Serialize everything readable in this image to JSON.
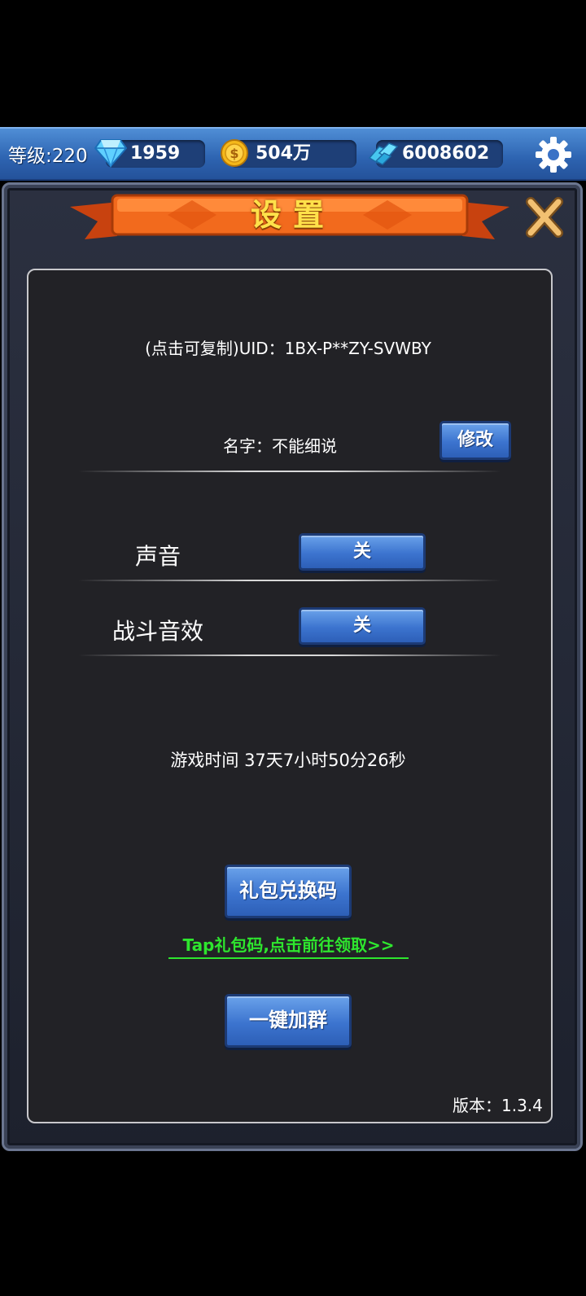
{
  "topbar": {
    "level": "等级:220",
    "diamonds": "1959",
    "gold": "504万",
    "crystals": "6008602"
  },
  "dialog": {
    "title": "设置",
    "uid": "(点击可复制)UID：1BX-P**ZY-SVWBY",
    "name": "名字：不能细说",
    "modify_button": "修改",
    "sound_label": "声音",
    "sound_value": "关",
    "battle_sound_label": "战斗音效",
    "battle_sound_value": "关",
    "play_time": "游戏时间 37天7小时50分26秒",
    "gift_code_button": "礼包兑换码",
    "gift_link": "Tap礼包码,点击前往领取>>",
    "join_group_button": "一键加群",
    "version": "版本：1.3.4"
  },
  "colors": {
    "accent_blue": "#3c74cf",
    "title_yellow": "#ffe14a",
    "ribbon_orange": "#f06a1e",
    "link_green": "#2ee62e"
  },
  "icons": [
    "diamond-icon",
    "gold-coin-icon",
    "crystal-icon",
    "gear-icon",
    "close-icon"
  ]
}
